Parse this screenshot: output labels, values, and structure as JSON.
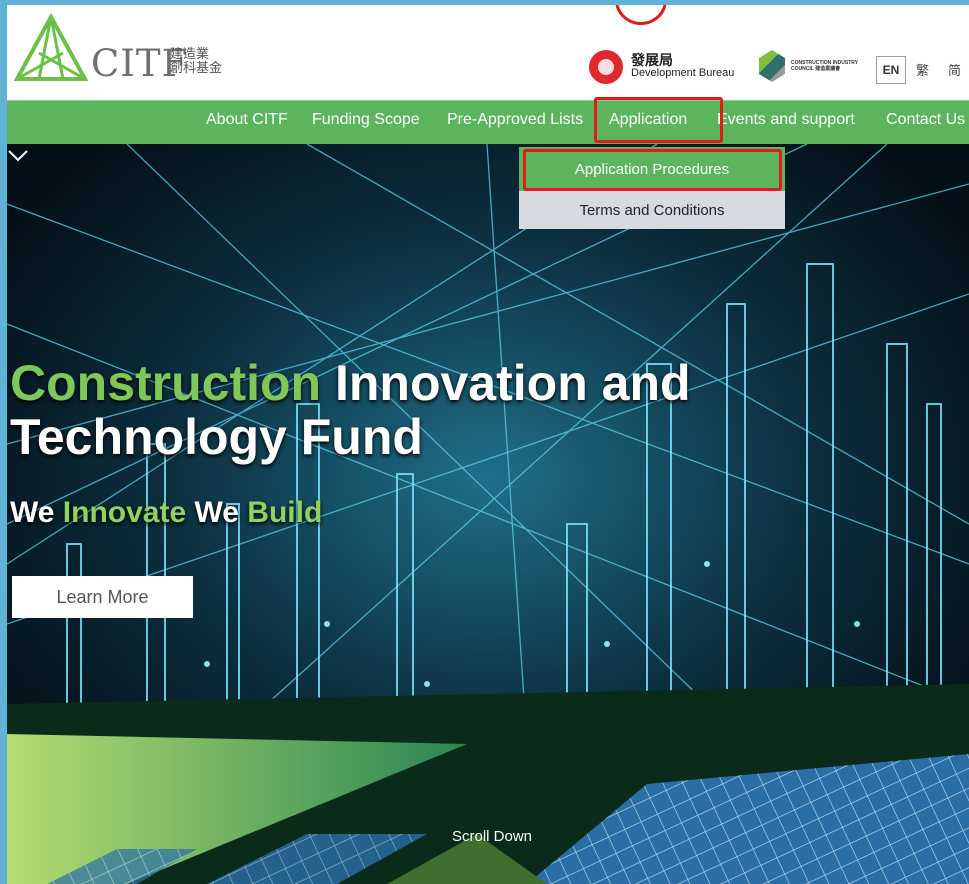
{
  "header": {
    "logo_text": "CITF",
    "logo_cn_line1": "建造業",
    "logo_cn_line2": "創科基金",
    "devb_cn": "發展局",
    "devb_en": "Development Bureau",
    "cic_text": "CONSTRUCTION INDUSTRY COUNCIL 建造業議會",
    "lang_en": "EN",
    "lang_tc": "繁",
    "lang_sc": "简"
  },
  "nav": {
    "items": [
      {
        "label": "About CITF"
      },
      {
        "label": "Funding Scope"
      },
      {
        "label": "Pre-Approved Lists"
      },
      {
        "label": "Application"
      },
      {
        "label": "Events and support"
      },
      {
        "label": "Contact Us"
      }
    ]
  },
  "dropdown": {
    "items": [
      {
        "label": "Application Procedures"
      },
      {
        "label": "Terms and Conditions"
      }
    ]
  },
  "hero": {
    "title_green": "Construction",
    "title_white_1": " Innovation and",
    "title_line2": "Technology Fund",
    "tag_we1": "We ",
    "tag_innovate": "Innovate",
    "tag_we2": " We ",
    "tag_build": "Build",
    "learn_more": "Learn More",
    "scroll_down": "Scroll Down"
  },
  "colors": {
    "nav_green": "#5cb55d",
    "highlight_red": "#e21a1a",
    "accent_green": "#7fc75a",
    "dropdown_grey": "#d5dbe0"
  }
}
